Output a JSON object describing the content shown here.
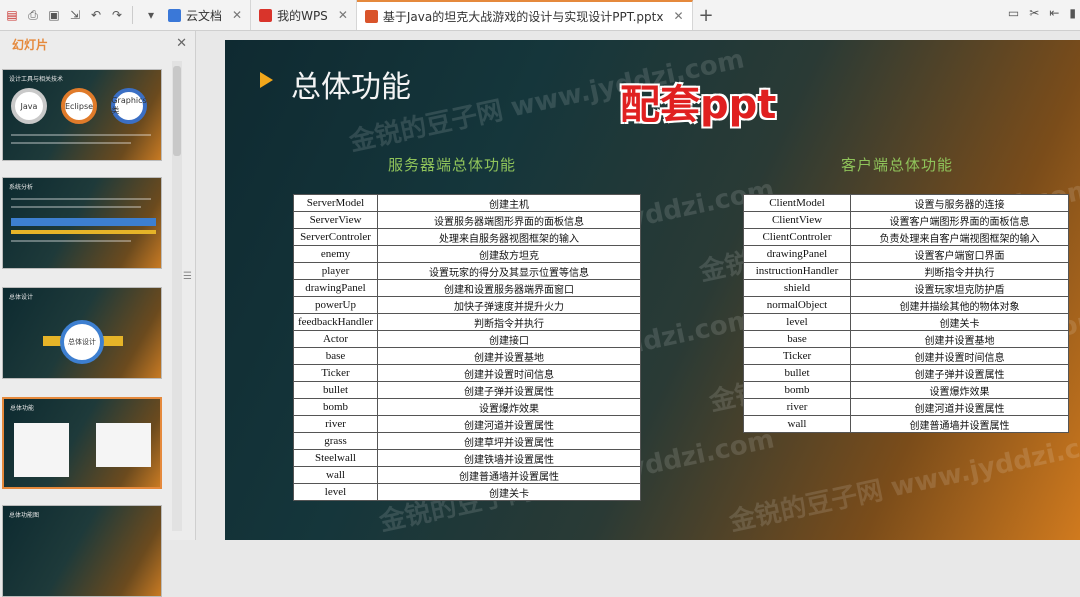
{
  "tabs": [
    {
      "label": "云文档",
      "icon": "cloud-doc-icon",
      "color": "#3a78d8"
    },
    {
      "label": "我的WPS",
      "icon": "wps-logo-icon",
      "color": "#d9342b"
    },
    {
      "label": "基于Java的坦克大战游戏的设计与实现设计PPT.pptx",
      "icon": "pptx-file-icon",
      "color": "#d9542b",
      "active": true
    }
  ],
  "left_panel": {
    "title": "幻灯片",
    "thumbnails": [
      {
        "title": "设计工具与相关技术",
        "circles": [
          "Java",
          "Eclipse",
          "Graphics类"
        ]
      },
      {
        "title": "系统分析"
      },
      {
        "title": "总体设计",
        "center": "总体设计"
      },
      {
        "title": "总体功能"
      },
      {
        "title": "总体功能图"
      }
    ]
  },
  "slide": {
    "title": "总体功能",
    "stamp": "配套ppt",
    "watermark": "金锐的豆子网 www.jyddzi.com",
    "server": {
      "heading": "服务器端总体功能",
      "rows": [
        [
          "ServerModel",
          "创建主机"
        ],
        [
          "ServerView",
          "设置服务器端图形界面的面板信息"
        ],
        [
          "ServerControler",
          "处理来自服务器视图框架的输入"
        ],
        [
          "enemy",
          "创建敌方坦克"
        ],
        [
          "player",
          "设置玩家的得分及其显示位置等信息"
        ],
        [
          "drawingPanel",
          "创建和设置服务器端界面窗口"
        ],
        [
          "powerUp",
          "加快子弹速度并提升火力"
        ],
        [
          "feedbackHandler",
          "判断指令并执行"
        ],
        [
          "Actor",
          "创建接口"
        ],
        [
          "base",
          "创建并设置基地"
        ],
        [
          "Ticker",
          "创建并设置时间信息"
        ],
        [
          "bullet",
          "创建子弹并设置属性"
        ],
        [
          "bomb",
          "设置爆炸效果"
        ],
        [
          "river",
          "创建河道并设置属性"
        ],
        [
          "grass",
          "创建草坪并设置属性"
        ],
        [
          "Steelwall",
          "创建铁墙并设置属性"
        ],
        [
          "wall",
          "创建普通墙并设置属性"
        ],
        [
          "level",
          "创建关卡"
        ]
      ]
    },
    "client": {
      "heading": "客户端总体功能",
      "rows": [
        [
          "ClientModel",
          "设置与服务器的连接"
        ],
        [
          "ClientView",
          "设置客户端图形界面的面板信息"
        ],
        [
          "ClientControler",
          "负责处理来自客户端视图框架的输入"
        ],
        [
          "drawingPanel",
          "设置客户端窗口界面"
        ],
        [
          "instructionHandler",
          "判断指令并执行"
        ],
        [
          "shield",
          "设置玩家坦克防护盾"
        ],
        [
          "normalObject",
          "创建并描绘其他的物体对象"
        ],
        [
          "level",
          "创建关卡"
        ],
        [
          "base",
          "创建并设置基地"
        ],
        [
          "Ticker",
          "创建并设置时间信息"
        ],
        [
          "bullet",
          "创建子弹并设置属性"
        ],
        [
          "bomb",
          "设置爆炸效果"
        ],
        [
          "river",
          "创建河道并设置属性"
        ],
        [
          "wall",
          "创建普通墙并设置属性"
        ]
      ]
    }
  },
  "colors": {
    "accent": "#e5893c",
    "title_text": "#f4f4f4",
    "heading_green": "#8fc35a",
    "stamp_red": "#e02020"
  }
}
